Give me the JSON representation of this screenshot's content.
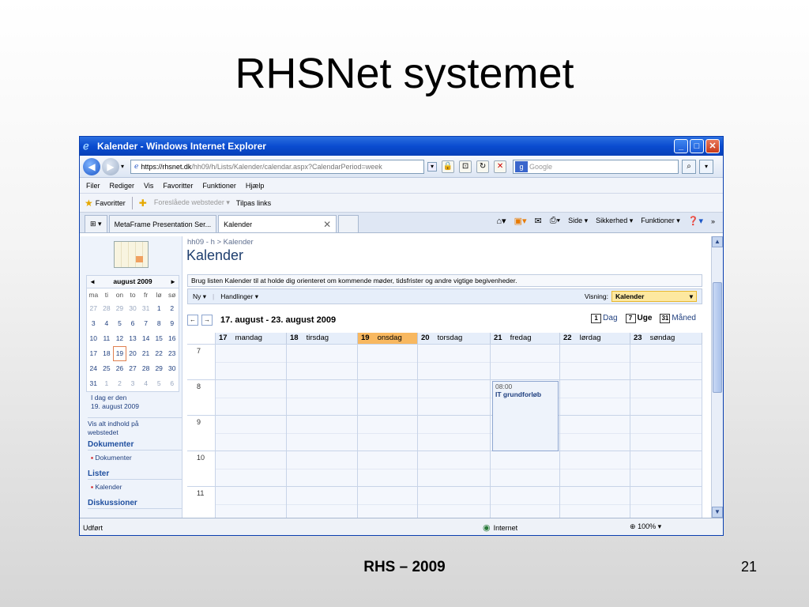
{
  "slide": {
    "title": "RHSNet systemet",
    "footer": "RHS – 2009",
    "page_number": "21"
  },
  "window": {
    "title": "Kalender - Windows Internet Explorer",
    "controls": [
      "_",
      "□",
      "✕"
    ]
  },
  "address": {
    "prefix": "https://",
    "host": "rhsnet.dk",
    "path": "/hh09/h/Lists/Kalender/calendar.aspx?CalendarPeriod=week",
    "search_placeholder": "Google"
  },
  "menu": [
    "Filer",
    "Rediger",
    "Vis",
    "Favoritter",
    "Funktioner",
    "Hjælp"
  ],
  "favbar": {
    "favorites": "Favoritter",
    "suggested": "Foreslåede websteder ▾",
    "custom": "Tilpas links"
  },
  "tabs": [
    {
      "label": "MetaFrame Presentation Ser..."
    },
    {
      "label": "Kalender",
      "close": "✕"
    }
  ],
  "commands": {
    "page": "Side ▾",
    "safety": "Sikkerhed ▾",
    "tools": "Funktioner ▾",
    "more": "»"
  },
  "leftnav": {
    "month_label": "august 2009",
    "prev": "◂",
    "next": "▸",
    "weekdays": [
      "ma",
      "ti",
      "on",
      "to",
      "fr",
      "lø",
      "sø"
    ],
    "weeks": [
      [
        "27",
        "28",
        "29",
        "30",
        "31",
        "1",
        "2"
      ],
      [
        "3",
        "4",
        "5",
        "6",
        "7",
        "8",
        "9"
      ],
      [
        "10",
        "11",
        "12",
        "13",
        "14",
        "15",
        "16"
      ],
      [
        "17",
        "18",
        "19",
        "20",
        "21",
        "22",
        "23"
      ],
      [
        "24",
        "25",
        "26",
        "27",
        "28",
        "29",
        "30"
      ],
      [
        "31",
        "1",
        "2",
        "3",
        "4",
        "5",
        "6"
      ]
    ],
    "today_line1": "I dag er den",
    "today_line2": "19. august 2009",
    "view_all_line1": "Vis alt indhold på",
    "view_all_line2": "webstedet",
    "sections": [
      {
        "title": "Dokumenter",
        "item": "Dokumenter"
      },
      {
        "title": "Lister",
        "item": "Kalender"
      },
      {
        "title": "Diskussioner",
        "item": ""
      }
    ]
  },
  "main": {
    "breadcrumb": "hh09 - h > Kalender",
    "title": "Kalender",
    "description": "Brug listen Kalender til at holde dig orienteret om kommende møder, tidsfrister og andre vigtige begivenheder.",
    "toolbar": {
      "new": "Ny ▾",
      "actions": "Handlinger ▾",
      "view_label": "Visning:",
      "view_value": "Kalender",
      "view_caret": "▾"
    },
    "week_range": "17. august - 23. august 2009",
    "nav_prev": "←",
    "nav_next": "→",
    "modes": [
      {
        "icon": "1",
        "label": "Dag"
      },
      {
        "icon": "7",
        "label": "Uge"
      },
      {
        "icon": "31",
        "label": "Måned"
      }
    ],
    "days": [
      {
        "num": "17",
        "name": "mandag"
      },
      {
        "num": "18",
        "name": "tirsdag"
      },
      {
        "num": "19",
        "name": "onsdag"
      },
      {
        "num": "20",
        "name": "torsdag"
      },
      {
        "num": "21",
        "name": "fredag"
      },
      {
        "num": "22",
        "name": "lørdag"
      },
      {
        "num": "23",
        "name": "søndag"
      }
    ],
    "hours": [
      "7",
      "8",
      "9",
      "10",
      "11"
    ],
    "event": {
      "time": "08:00",
      "title": "IT grundforløb"
    }
  },
  "status": {
    "left": "Udført",
    "zone": "Internet",
    "zoom": "100%"
  }
}
